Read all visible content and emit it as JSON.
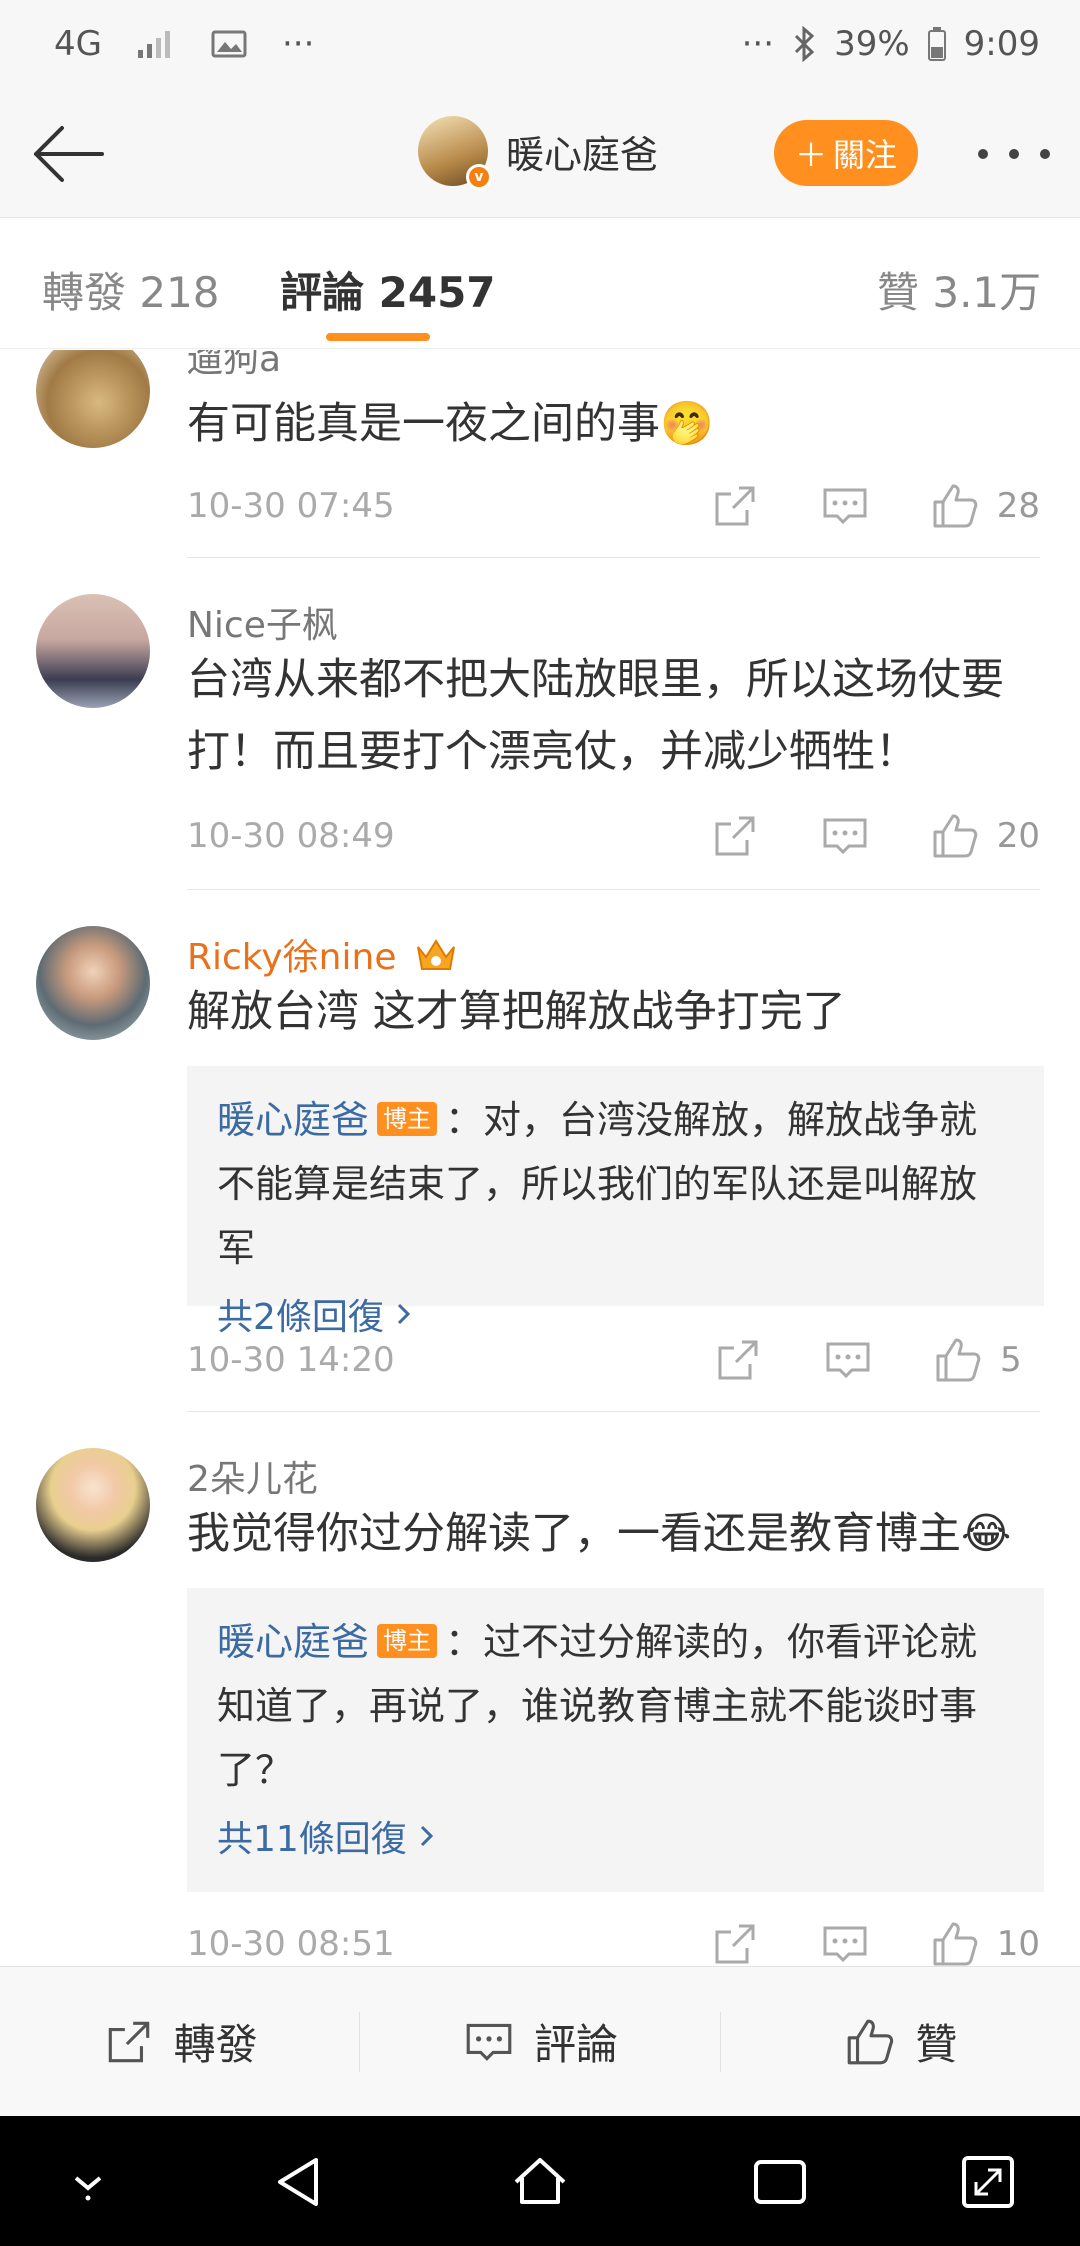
{
  "status_bar": {
    "network": "4G",
    "overflow": "···",
    "battery": "39%",
    "time": "9:09"
  },
  "header": {
    "title": "暖心庭爸",
    "follow_label": "關注"
  },
  "tabs": [
    {
      "label": "轉發 218"
    },
    {
      "label": "評論 2457"
    },
    {
      "label": "贊 3.1万"
    }
  ],
  "comments": [
    {
      "user": "遛狗a",
      "text": "有可能真是一夜之间的事🤭",
      "time": "10-30 07:45",
      "likes": "28"
    },
    {
      "user": "Nice子枫",
      "text": "台湾从来都不把大陆放眼里，所以这场仗要打！而且要打个漂亮仗，并减少牺牲！",
      "time": "10-30 08:49",
      "likes": "20"
    },
    {
      "user": "Ricky徐nine",
      "text": "解放台湾 这才算把解放战争打完了",
      "reply_user": "暖心庭爸",
      "reply_badge": "博主",
      "reply_text": "：对，台湾没解放，解放战争就不能算是结束了，所以我们的军队还是叫解放军",
      "reply_more": "共2條回復",
      "time": "10-30 14:20",
      "likes": "5"
    },
    {
      "user": "2朵儿花",
      "text": "我觉得你过分解读了，一看还是教育博主😂",
      "reply_user": "暖心庭爸",
      "reply_badge": "博主",
      "reply_text": "：过不过分解读的，你看评论就知道了，再说了，谁说教育博主就不能谈时事了？",
      "reply_more": "共11條回復",
      "time": "10-30 08:51",
      "likes": "10"
    }
  ],
  "bottom_bar": {
    "repost_label": "轉發",
    "comment_label": "評論",
    "like_label": "贊"
  },
  "colors": {
    "accent": "#ff8f1f",
    "link": "#3c6aa3",
    "vip_name": "#e8711b"
  }
}
